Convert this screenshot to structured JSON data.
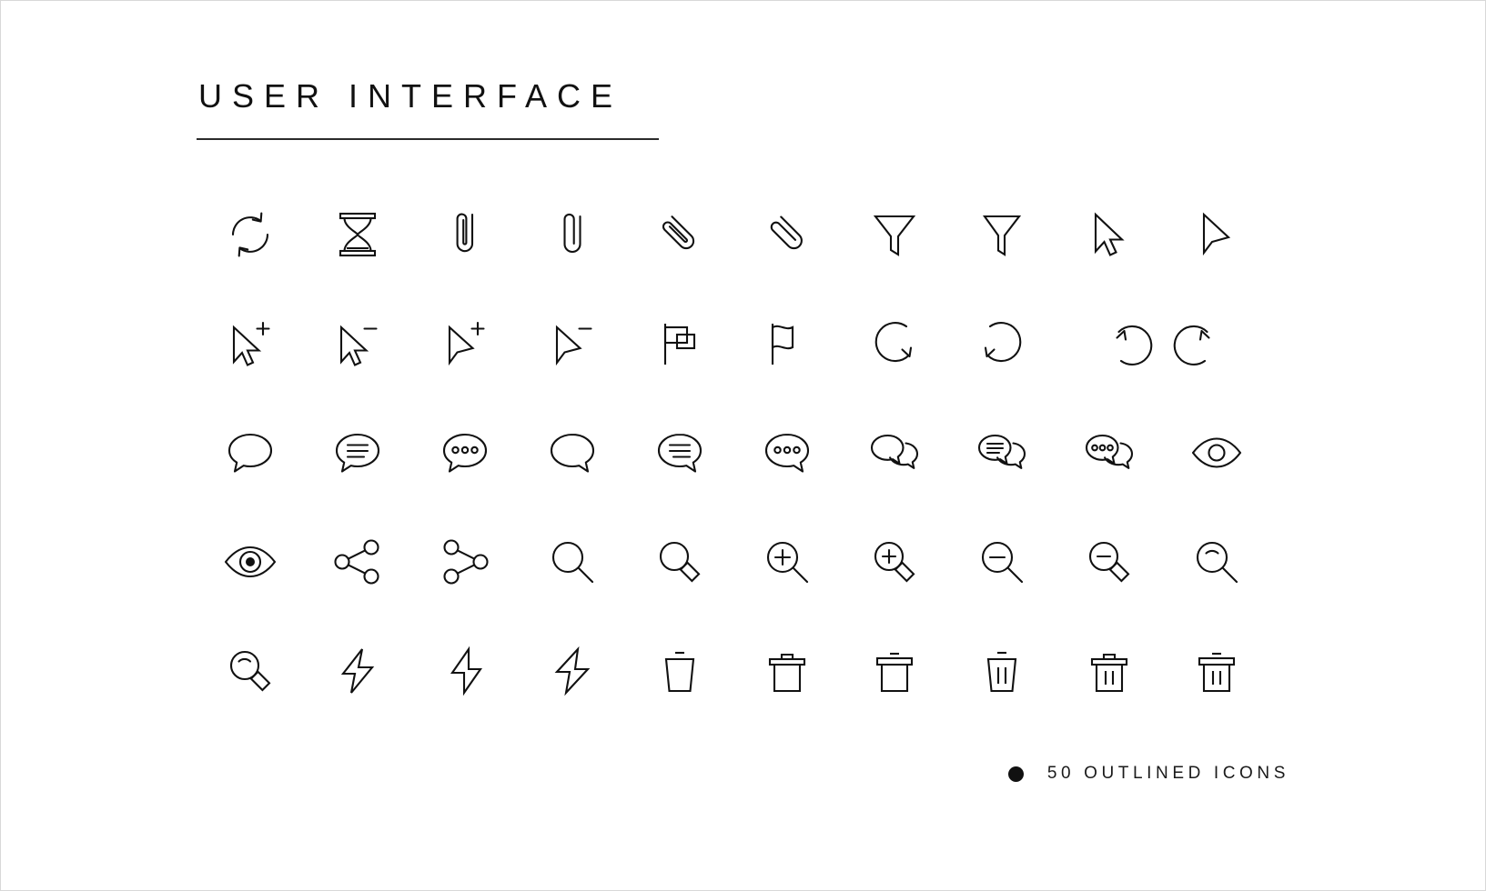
{
  "page": {
    "title": "USER INTERFACE",
    "background_color": "#ffffff",
    "stroke_color": "#111111",
    "rule_color": "#2b2b2b"
  },
  "footer": {
    "bullet": "filled-circle",
    "text": "50 OUTLINED ICONS",
    "count": 50
  },
  "grid": {
    "columns": 10,
    "rows": 5,
    "total": 50
  },
  "icons": [
    {
      "index": 1,
      "name": "refresh-icon",
      "label": "Refresh / sync circular arrows"
    },
    {
      "index": 2,
      "name": "hourglass-icon",
      "label": "Hourglass"
    },
    {
      "index": 3,
      "name": "paperclip-vertical-icon",
      "label": "Paperclip vertical"
    },
    {
      "index": 4,
      "name": "paperclip-vertical-open-icon",
      "label": "Paperclip vertical open"
    },
    {
      "index": 5,
      "name": "paperclip-diagonal-icon",
      "label": "Paperclip diagonal"
    },
    {
      "index": 6,
      "name": "paperclip-diagonal-alt-icon",
      "label": "Paperclip diagonal alternate"
    },
    {
      "index": 7,
      "name": "filter-funnel-icon",
      "label": "Filter funnel"
    },
    {
      "index": 8,
      "name": "filter-funnel-alt-icon",
      "label": "Filter funnel alternate"
    },
    {
      "index": 9,
      "name": "cursor-pointer-icon",
      "label": "Cursor pointer"
    },
    {
      "index": 10,
      "name": "cursor-arrow-icon",
      "label": "Cursor arrow"
    },
    {
      "index": 11,
      "name": "cursor-pointer-add-icon",
      "label": "Cursor pointer add"
    },
    {
      "index": 12,
      "name": "cursor-pointer-remove-icon",
      "label": "Cursor pointer remove"
    },
    {
      "index": 13,
      "name": "cursor-arrow-add-icon",
      "label": "Cursor arrow add"
    },
    {
      "index": 14,
      "name": "cursor-arrow-remove-icon",
      "label": "Cursor arrow remove"
    },
    {
      "index": 15,
      "name": "flag-rectangular-icon",
      "label": "Flag rectangular"
    },
    {
      "index": 16,
      "name": "flag-wavy-icon",
      "label": "Flag wavy"
    },
    {
      "index": 17,
      "name": "rotate-clockwise-icon",
      "label": "Rotate clockwise"
    },
    {
      "index": 18,
      "name": "rotate-counterclockwise-icon",
      "label": "Rotate counterclockwise"
    },
    {
      "index": 19,
      "name": "redo-icon",
      "label": "Redo circular arrow"
    },
    {
      "index": 20,
      "name": "undo-icon",
      "label": "Undo circular arrow"
    },
    {
      "index": 21,
      "name": "speech-bubble-icon",
      "label": "Speech bubble"
    },
    {
      "index": 22,
      "name": "speech-bubble-lines-icon",
      "label": "Speech bubble with lines"
    },
    {
      "index": 23,
      "name": "speech-bubble-dots-icon",
      "label": "Speech bubble with dots"
    },
    {
      "index": 24,
      "name": "speech-bubble-left-icon",
      "label": "Speech bubble left tail"
    },
    {
      "index": 25,
      "name": "speech-bubble-lines-left-icon",
      "label": "Speech bubble lines left tail"
    },
    {
      "index": 26,
      "name": "speech-bubble-dots-left-icon",
      "label": "Speech bubble dots left tail"
    },
    {
      "index": 27,
      "name": "chat-double-icon",
      "label": "Double chat bubbles"
    },
    {
      "index": 28,
      "name": "chat-double-lines-icon",
      "label": "Double chat bubbles with lines"
    },
    {
      "index": 29,
      "name": "chat-double-dots-icon",
      "label": "Double chat bubbles with dots"
    },
    {
      "index": 30,
      "name": "eye-icon",
      "label": "Eye"
    },
    {
      "index": 31,
      "name": "eye-bold-icon",
      "label": "Eye large pupil"
    },
    {
      "index": 32,
      "name": "share-nodes-left-icon",
      "label": "Share nodes left"
    },
    {
      "index": 33,
      "name": "share-nodes-right-icon",
      "label": "Share nodes right"
    },
    {
      "index": 34,
      "name": "search-icon",
      "label": "Magnifying glass"
    },
    {
      "index": 35,
      "name": "search-handle-icon",
      "label": "Magnifying glass thick handle"
    },
    {
      "index": 36,
      "name": "zoom-in-icon",
      "label": "Zoom in"
    },
    {
      "index": 37,
      "name": "zoom-in-handle-icon",
      "label": "Zoom in thick handle"
    },
    {
      "index": 38,
      "name": "zoom-out-icon",
      "label": "Zoom out"
    },
    {
      "index": 39,
      "name": "zoom-out-handle-icon",
      "label": "Zoom out thick handle"
    },
    {
      "index": 40,
      "name": "search-shine-icon",
      "label": "Magnifying glass with shine"
    },
    {
      "index": 41,
      "name": "search-shine-handle-icon",
      "label": "Magnifying glass shine thick handle"
    },
    {
      "index": 42,
      "name": "lightning-bolt-icon",
      "label": "Lightning bolt"
    },
    {
      "index": 43,
      "name": "lightning-bolt-thin-icon",
      "label": "Lightning bolt thin"
    },
    {
      "index": 44,
      "name": "lightning-bolt-alt-icon",
      "label": "Lightning bolt alternate"
    },
    {
      "index": 45,
      "name": "trash-simple-icon",
      "label": "Trash can simple"
    },
    {
      "index": 46,
      "name": "trash-lid-handle-icon",
      "label": "Trash can with handled lid"
    },
    {
      "index": 47,
      "name": "trash-lid-icon",
      "label": "Trash can with lid"
    },
    {
      "index": 48,
      "name": "trash-lines-icon",
      "label": "Trash can with lines"
    },
    {
      "index": 49,
      "name": "trash-lid-handle-lines-icon",
      "label": "Trash can handled lid with lines"
    },
    {
      "index": 50,
      "name": "trash-lid-lines-icon",
      "label": "Trash can lid with lines"
    }
  ]
}
